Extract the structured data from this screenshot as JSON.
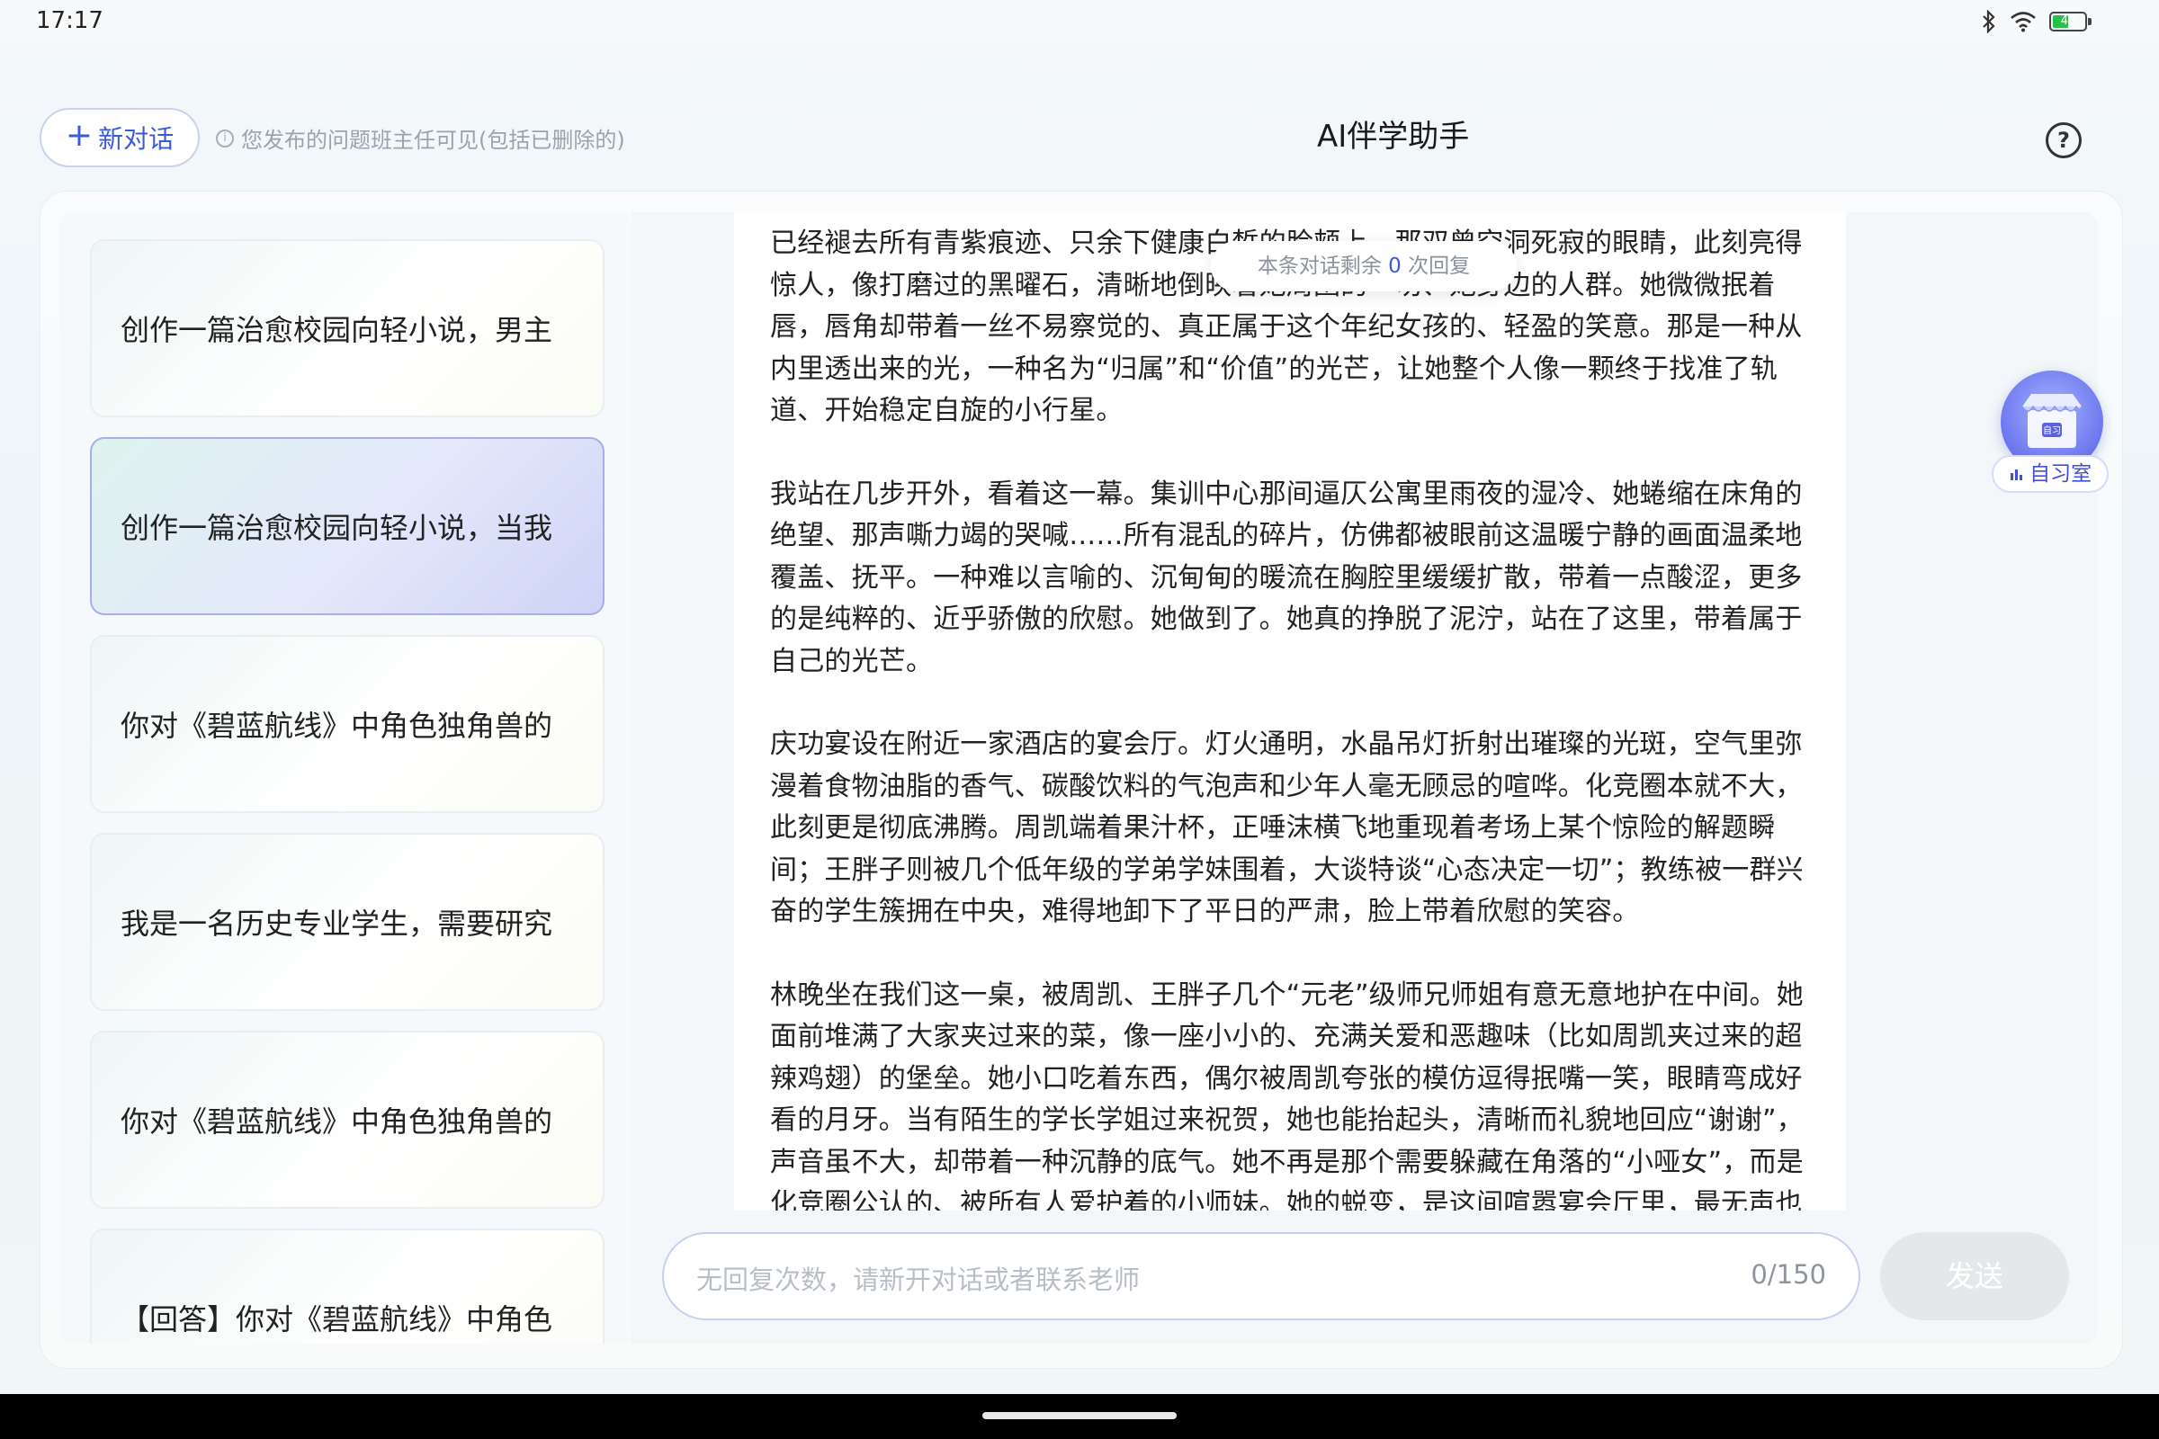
{
  "status_bar": {
    "time": "17:17",
    "battery_level": "46"
  },
  "header": {
    "new_chat_plus": "+",
    "new_chat_label": "新对话",
    "notice_text": "您发布的问题班主任可见(包括已删除的)",
    "title": "AI伴学助手",
    "help_symbol": "?"
  },
  "history": [
    {
      "label": "创作一篇治愈校园向轻小说，男主",
      "active": false
    },
    {
      "label": "创作一篇治愈校园向轻小说，当我",
      "active": true
    },
    {
      "label": "你对《碧蓝航线》中角色独角兽的",
      "active": false
    },
    {
      "label": "我是一名历史专业学生，需要研究",
      "active": false
    },
    {
      "label": "你对《碧蓝航线》中角色独角兽的",
      "active": false
    },
    {
      "label": "【回答】你对《碧蓝航线》中角色",
      "active": false
    }
  ],
  "remaining": {
    "prefix": "本条对话剩余",
    "count": "0",
    "suffix": "次回复"
  },
  "content": {
    "paragraphs": [
      "已经褪去所有青紫痕迹、只余下健康白皙的脸颊上，那双曾空洞死寂的眼睛，此刻亮得惊人，像打磨过的黑曜石，清晰地倒映着她周围的一切、她身边的人群。她微微抿着唇，唇角却带着一丝不易察觉的、真正属于这个年纪女孩的、轻盈的笑意。那是一种从内里透出来的光，一种名为“归属”和“价值”的光芒，让她整个人像一颗终于找准了轨道、开始稳定自旋的小行星。",
      "我站在几步开外，看着这一幕。集训中心那间逼仄公寓里雨夜的湿冷、她蜷缩在床角的绝望、那声嘶力竭的哭喊……所有混乱的碎片，仿佛都被眼前这温暖宁静的画面温柔地覆盖、抚平。一种难以言喻的、沉甸甸的暖流在胸腔里缓缓扩散，带着一点酸涩，更多的是纯粹的、近乎骄傲的欣慰。她做到了。她真的挣脱了泥泞，站在了这里，带着属于自己的光芒。",
      "庆功宴设在附近一家酒店的宴会厅。灯火通明，水晶吊灯折射出璀璨的光斑，空气里弥漫着食物油脂的香气、碳酸饮料的气泡声和少年人毫无顾忌的喧哗。化竞圈本就不大，此刻更是彻底沸腾。周凯端着果汁杯，正唾沫横飞地重现着考场上某个惊险的解题瞬间；王胖子则被几个低年级的学弟学妹围着，大谈特谈“心态决定一切”；教练被一群兴奋的学生簇拥在中央，难得地卸下了平日的严肃，脸上带着欣慰的笑容。",
      "林晚坐在我们这一桌，被周凯、王胖子几个“元老”级师兄师姐有意无意地护在中间。她面前堆满了大家夹过来的菜，像一座小小的、充满关爱和恶趣味（比如周凯夹过来的超辣鸡翅）的堡垒。她小口吃着东西，偶尔被周凯夸张的模仿逗得抿嘴一笑，眼睛弯成好看的月牙。当有陌生的学长学姐过来祝贺，她也能抬起头，清晰而礼貌地回应“谢谢”，声音虽不大，却带着一种沉静的底气。她不再是那个需要躲藏在角落的“小哑女”，而是化竞圈公认的、被所有人爱护着的小师妹。她的蜕变，是这间喧嚣宴会厅里，最无声也最动人"
    ]
  },
  "input": {
    "placeholder": "无回复次数，请新开对话或者联系老师",
    "counter": "0/150"
  },
  "send_label": "发送",
  "study_room": {
    "badge": "自习",
    "label": "自习室"
  },
  "colors": {
    "accent": "#3b5bd6",
    "active_item_border": "#a7aee9",
    "send_disabled": "#e5e8ea"
  }
}
